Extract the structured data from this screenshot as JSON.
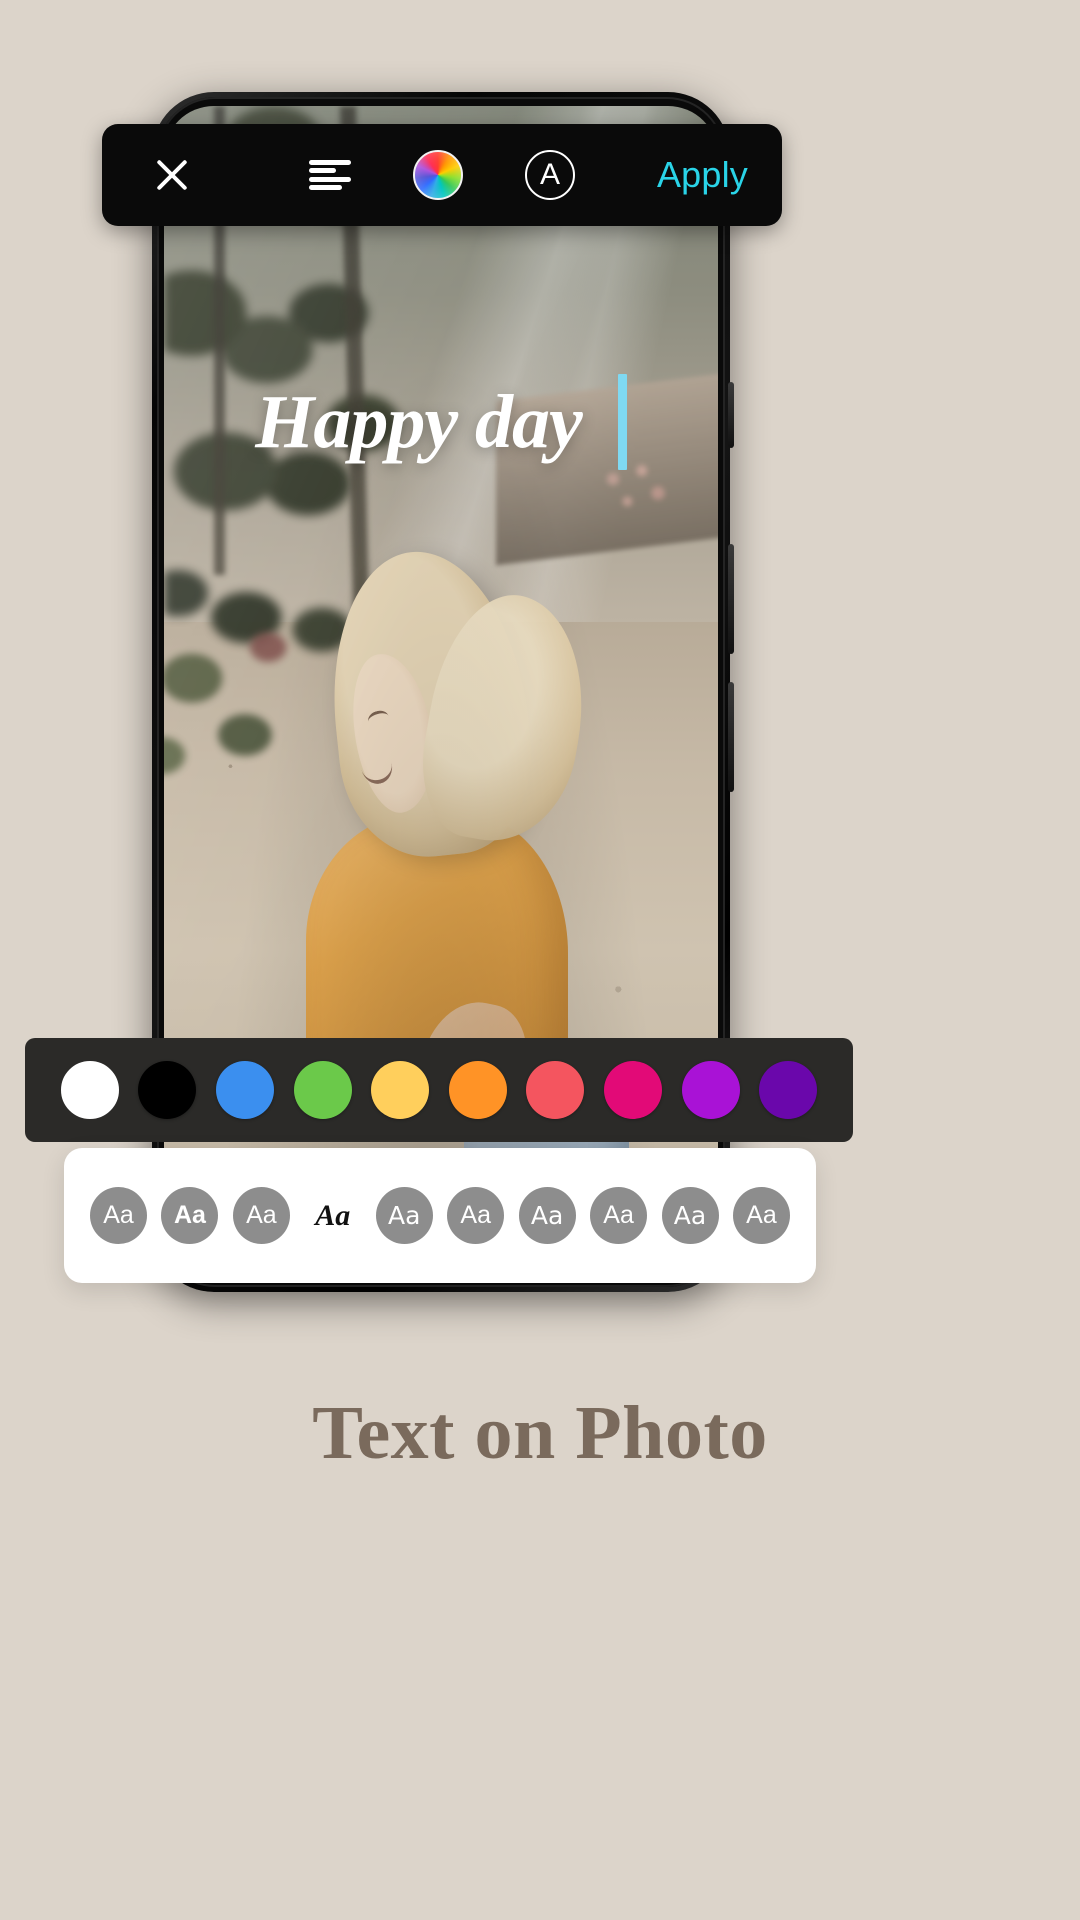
{
  "app": {
    "background_color": "#dcd4ca",
    "caption": "Text on Photo"
  },
  "toolbar": {
    "close_label": "close-icon",
    "align_label": "text-align-left-icon",
    "color_wheel_label": "color-wheel-icon",
    "font_style_label": "A",
    "apply_label": "Apply",
    "apply_color": "#2ad4e8",
    "background_color": "#0a0a0a"
  },
  "canvas": {
    "overlay_text": "Happy day",
    "caret_color": "#7fd9f2",
    "text_color": "#ffffff"
  },
  "color_picker": {
    "background_color": "#2b2a28",
    "swatches": [
      {
        "name": "white",
        "hex": "#ffffff",
        "selected": true
      },
      {
        "name": "black",
        "hex": "#000000",
        "selected": false
      },
      {
        "name": "blue",
        "hex": "#3b8fef",
        "selected": false
      },
      {
        "name": "green",
        "hex": "#6bc94a",
        "selected": false
      },
      {
        "name": "yellow",
        "hex": "#ffcf5c",
        "selected": false
      },
      {
        "name": "orange",
        "hex": "#ff9326",
        "selected": false
      },
      {
        "name": "red",
        "hex": "#f4555f",
        "selected": false
      },
      {
        "name": "magenta",
        "hex": "#e20a77",
        "selected": false
      },
      {
        "name": "purple",
        "hex": "#a912d6",
        "selected": false
      },
      {
        "name": "violet",
        "hex": "#6a07ab",
        "selected": false
      }
    ]
  },
  "font_picker": {
    "background_color": "#ffffff",
    "chip_color": "#8d8d8d",
    "chips": [
      {
        "label": "Aa",
        "selected": false
      },
      {
        "label": "Aa",
        "selected": false
      },
      {
        "label": "Aa",
        "selected": false
      },
      {
        "label": "Aa",
        "selected": true
      },
      {
        "label": "Aa",
        "selected": false
      },
      {
        "label": "Aa",
        "selected": false
      },
      {
        "label": "Aa",
        "selected": false
      },
      {
        "label": "Aa",
        "selected": false
      },
      {
        "label": "Aa",
        "selected": false
      },
      {
        "label": "Aa",
        "selected": false
      }
    ]
  }
}
